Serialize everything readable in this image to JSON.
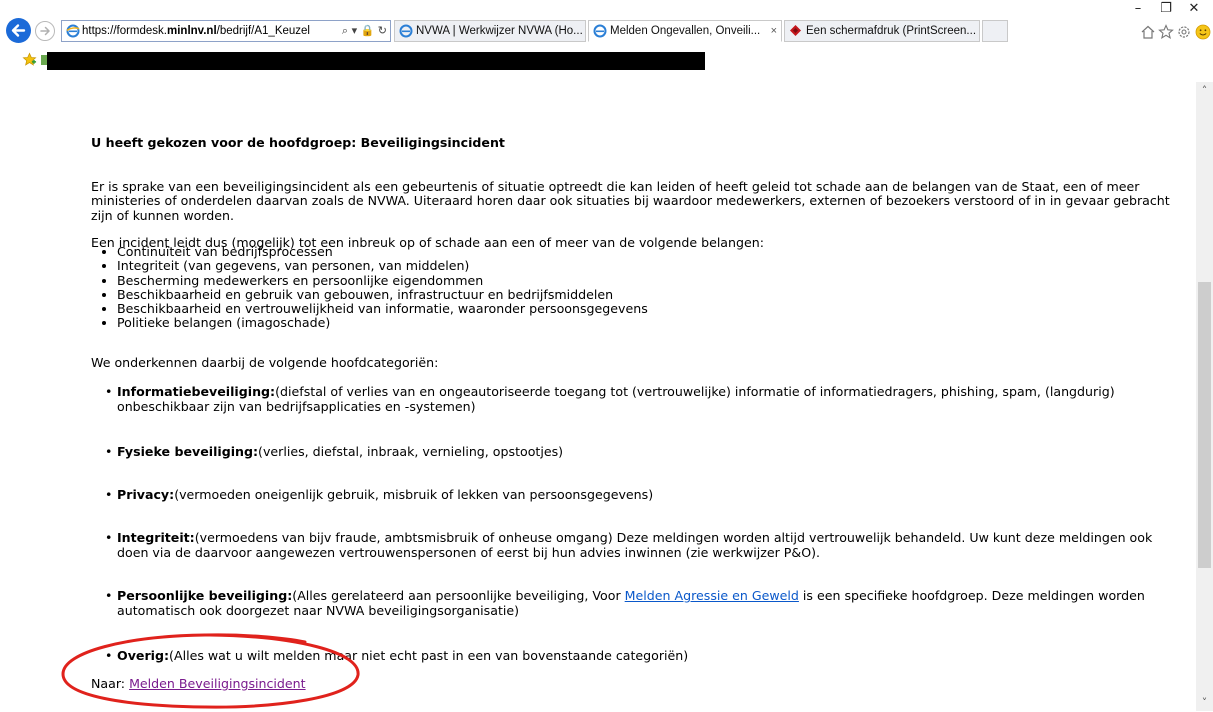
{
  "browser": {
    "url_prefix": "https://formdesk.",
    "url_domain": "minlnv.nl",
    "url_suffix": "/bedrijf/A1_Keuzel",
    "url_tools": "⌕ ▾ 🔒 ↻",
    "tabs": [
      {
        "label": "NVWA | Werkwijzer NVWA (Ho...",
        "active": false
      },
      {
        "label": "Melden Ongevallen, Onveili...",
        "active": true,
        "close": "×"
      },
      {
        "label": "Een schermafdruk (PrintScreen...",
        "active": false
      }
    ],
    "window_controls": {
      "minimize": "–",
      "restore": "❐",
      "close": "✕"
    },
    "scroll_up": "˄",
    "scroll_down": "˅",
    "colors": {
      "back_button": "#1b6ad8",
      "link": "#0a58ca",
      "visited_link": "#7a1c8e",
      "annotation": "#e0221c"
    }
  },
  "page": {
    "heading": "U heeft gekozen voor de hoofdgroep: Beveiligingsincident",
    "intro_line1": "Er is sprake van een beveiligingsincident als een gebeurtenis of situatie optreedt die kan leiden of heeft geleid tot schade aan de belangen van de Staat, een of meer ministeries of onderdelen daarvan zoals de NVWA. Uiteraard horen daar ook situaties bij waardoor medewerkers, externen of bezoekers verstoord of in in gevaar gebracht zijn of kunnen worden.",
    "intro_line2": "Een incident leidt dus (mogelijk) tot een inbreuk op of schade aan een of meer van de volgende belangen:",
    "interests": [
      "Continuïteit van bedrijfsprocessen",
      "Integriteit (van gegevens, van personen, van middelen)",
      "Bescherming medewerkers en persoonlijke eigendommen",
      "Beschikbaarheid en gebruik van gebouwen, infrastructuur en bedrijfsmiddelen",
      "Beschikbaarheid en vertrouwelijkheid van informatie, waaronder persoonsgegevens",
      "Politieke belangen (imagoschade)"
    ],
    "subcategories_intro": "We onderkennen daarbij de volgende hoofdcategoriën:",
    "categories": [
      {
        "title": "Informatiebeveiliging:",
        "text": "(diefstal of verlies van en ongeautoriseerde toegang tot (vertrouwelijke) informatie of informatiedragers, phishing, spam, (langdurig) onbeschikbaar zijn van bedrijfsapplicaties en -systemen)"
      },
      {
        "title": "Fysieke beveiliging:",
        "text": "(verlies, diefstal, inbraak, vernieling, opstootjes)"
      },
      {
        "title": "Privacy:",
        "text": "(vermoeden oneigenlijk gebruik, misbruik of lekken van persoonsgegevens)"
      },
      {
        "title": "Integriteit:",
        "text": "(vermoedens van bijv fraude, ambtsmisbruik of onheuse omgang) Deze meldingen worden altijd vertrouwelijk behandeld. Uw kunt deze meldingen ook doen via de daarvoor aangewezen vertrouwenspersonen of eerst bij hun advies inwinnen (zie werkwijzer P&O)."
      },
      {
        "title": "Persoonlijke beveiliging:",
        "text_before": "(Alles gerelateerd aan persoonlijke beveiliging, Voor ",
        "link": "Melden Agressie en Geweld",
        "text_after": " is een specifieke hoofdgroep. Deze meldingen worden automatisch ook doorgezet naar NVWA beveiligingsorganisatie)"
      },
      {
        "title": "Overig:",
        "text": "(Alles wat u wilt melden maar niet echt past in een van bovenstaande categoriën)"
      }
    ],
    "naar_label": "Naar: ",
    "naar_link": "Melden Beveiligingsincident"
  }
}
